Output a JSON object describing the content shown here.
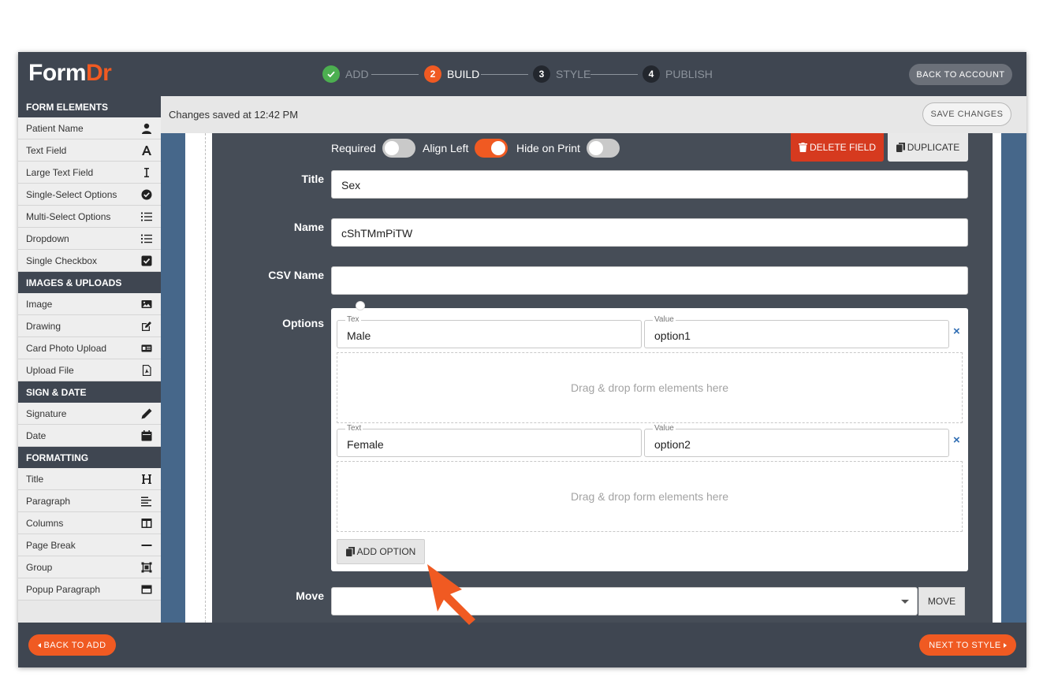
{
  "app": {
    "logo_part1": "Form",
    "logo_part2": "Dr"
  },
  "steps": [
    {
      "number": "1",
      "label": "ADD",
      "state": "done"
    },
    {
      "number": "2",
      "label": "BUILD",
      "state": "active"
    },
    {
      "number": "3",
      "label": "STYLE",
      "state": "todo"
    },
    {
      "number": "4",
      "label": "PUBLISH",
      "state": "todo"
    }
  ],
  "header": {
    "back_to_account": "BACK TO ACCOUNT"
  },
  "savebar": {
    "status": "Changes saved at 12:42 PM",
    "save_button": "SAVE CHANGES"
  },
  "sidebar": {
    "sections": [
      {
        "title": "FORM ELEMENTS",
        "items": [
          {
            "label": "Patient Name",
            "icon": "user-icon"
          },
          {
            "label": "Text Field",
            "icon": "letter-a-icon"
          },
          {
            "label": "Large Text Field",
            "icon": "text-cursor-icon"
          },
          {
            "label": "Single-Select Options",
            "icon": "check-circle-icon"
          },
          {
            "label": "Multi-Select Options",
            "icon": "list-icon"
          },
          {
            "label": "Dropdown",
            "icon": "list-icon"
          },
          {
            "label": "Single Checkbox",
            "icon": "checkbox-icon"
          }
        ]
      },
      {
        "title": "IMAGES & UPLOADS",
        "items": [
          {
            "label": "Image",
            "icon": "image-icon"
          },
          {
            "label": "Drawing",
            "icon": "edit-icon"
          },
          {
            "label": "Card Photo Upload",
            "icon": "id-card-icon"
          },
          {
            "label": "Upload File",
            "icon": "file-pdf-icon"
          }
        ]
      },
      {
        "title": "SIGN & DATE",
        "items": [
          {
            "label": "Signature",
            "icon": "pencil-icon"
          },
          {
            "label": "Date",
            "icon": "calendar-icon"
          }
        ]
      },
      {
        "title": "FORMATTING",
        "items": [
          {
            "label": "Title",
            "icon": "heading-icon"
          },
          {
            "label": "Paragraph",
            "icon": "align-left-icon"
          },
          {
            "label": "Columns",
            "icon": "columns-icon"
          },
          {
            "label": "Page Break",
            "icon": "minus-icon"
          },
          {
            "label": "Group",
            "icon": "group-icon"
          },
          {
            "label": "Popup Paragraph",
            "icon": "window-icon"
          }
        ]
      }
    ]
  },
  "editor": {
    "toggles": [
      {
        "label": "Required",
        "on": false
      },
      {
        "label": "Align Left",
        "on": true
      },
      {
        "label": "Hide on Print",
        "on": false
      }
    ],
    "delete_button": "DELETE FIELD",
    "duplicate_button": "DUPLICATE",
    "title_label": "Title",
    "title_value": "Sex",
    "name_label": "Name",
    "name_value": "cShTMmPiTW",
    "csv_label": "CSV Name",
    "csv_value": "",
    "options_label": "Options",
    "options": [
      {
        "text_tag": "Tex",
        "text": "Male",
        "value_tag": "Value",
        "value": "option1",
        "remove": "×"
      },
      {
        "text_tag": "Text",
        "text": "Female",
        "value_tag": "Value",
        "value": "option2",
        "remove": "×"
      }
    ],
    "dropzone_text": "Drag & drop form elements here",
    "add_option_button": "ADD OPTION",
    "move_label": "Move",
    "move_button": "MOVE"
  },
  "footer": {
    "back_to_add": "BACK TO ADD",
    "next_to_style": "NEXT TO STYLE"
  },
  "colors": {
    "accent": "#f05a22",
    "dark": "#3f4651",
    "canvas": "#46678a",
    "delete": "#d63a1f",
    "done": "#4caf50"
  }
}
